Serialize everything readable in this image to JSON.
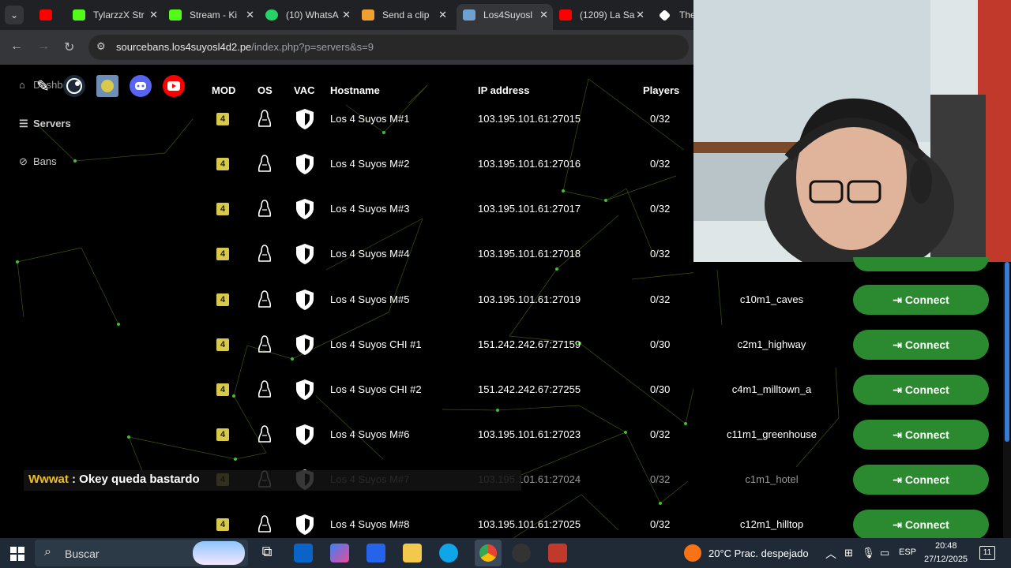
{
  "browser": {
    "tabs": [
      {
        "label": "",
        "color": "#ff0000"
      },
      {
        "label": "TylarzzX Str",
        "color": "#53fc18"
      },
      {
        "label": "Stream - Ki",
        "color": "#53fc18"
      },
      {
        "label": "(10) WhatsA",
        "color": "#25d366"
      },
      {
        "label": "Send a clip",
        "color": "#f0a030"
      },
      {
        "label": "Los4Suyosl",
        "color": "#6ea0d0"
      },
      {
        "label": "(1209) La Sa",
        "color": "#ff0000"
      },
      {
        "label": "The",
        "color": "#ffffff"
      }
    ],
    "url_domain": "sourcebans.los4suyosl4d2.pe",
    "url_path": "/index.php?p=servers&s=9"
  },
  "sidebar": {
    "dashboard_label": "Dashboard",
    "servers_label": "Servers",
    "bans_label": "Bans"
  },
  "table": {
    "headers": {
      "mod": "MOD",
      "os": "OS",
      "vac": "VAC",
      "hostname": "Hostname",
      "ip": "IP address",
      "players": "Players"
    },
    "rows": [
      {
        "mod": "4",
        "hostname": "Los 4 Suyos M#1",
        "ip": "103.195.101.61:27015",
        "players": "0/32",
        "map": "",
        "connect": ""
      },
      {
        "mod": "4",
        "hostname": "Los 4 Suyos M#2",
        "ip": "103.195.101.61:27016",
        "players": "0/32",
        "map": "",
        "connect": ""
      },
      {
        "mod": "4",
        "hostname": "Los 4 Suyos M#3",
        "ip": "103.195.101.61:27017",
        "players": "0/32",
        "map": "",
        "connect": ""
      },
      {
        "mod": "4",
        "hostname": "Los 4 Suyos M#4",
        "ip": "103.195.101.61:27018",
        "players": "0/32",
        "map": "",
        "connect": ""
      },
      {
        "mod": "4",
        "hostname": "Los 4 Suyos M#5",
        "ip": "103.195.101.61:27019",
        "players": "0/32",
        "map": "c10m1_caves",
        "connect": "Connect"
      },
      {
        "mod": "4",
        "hostname": "Los 4 Suyos CHI #1",
        "ip": "151.242.242.67:27159",
        "players": "0/30",
        "map": "c2m1_highway",
        "connect": "Connect"
      },
      {
        "mod": "4",
        "hostname": "Los 4 Suyos CHI #2",
        "ip": "151.242.242.67:27255",
        "players": "0/30",
        "map": "c4m1_milltown_a",
        "connect": "Connect"
      },
      {
        "mod": "4",
        "hostname": "Los 4 Suyos M#6",
        "ip": "103.195.101.61:27023",
        "players": "0/32",
        "map": "c11m1_greenhouse",
        "connect": "Connect"
      },
      {
        "mod": "4",
        "hostname": "Los 4 Suyos M#7",
        "ip": "103.195.101.61:27024",
        "players": "0/32",
        "map": "c1m1_hotel",
        "connect": "Connect"
      },
      {
        "mod": "4",
        "hostname": "Los 4 Suyos M#8",
        "ip": "103.195.101.61:27025",
        "players": "0/32",
        "map": "c12m1_hilltop",
        "connect": "Connect"
      }
    ]
  },
  "chat_overlay": {
    "user": "Wwwat",
    "message": " : Okey queda bastardo"
  },
  "taskbar": {
    "search_placeholder": "Buscar",
    "weather": "20°C  Prac. despejado",
    "language": "ESP",
    "time": "20:48",
    "date": "27/12/2025",
    "notifications": "11"
  },
  "colors": {
    "connect_button": "#2b8a2f",
    "mod_badge": "#d9c94b"
  }
}
